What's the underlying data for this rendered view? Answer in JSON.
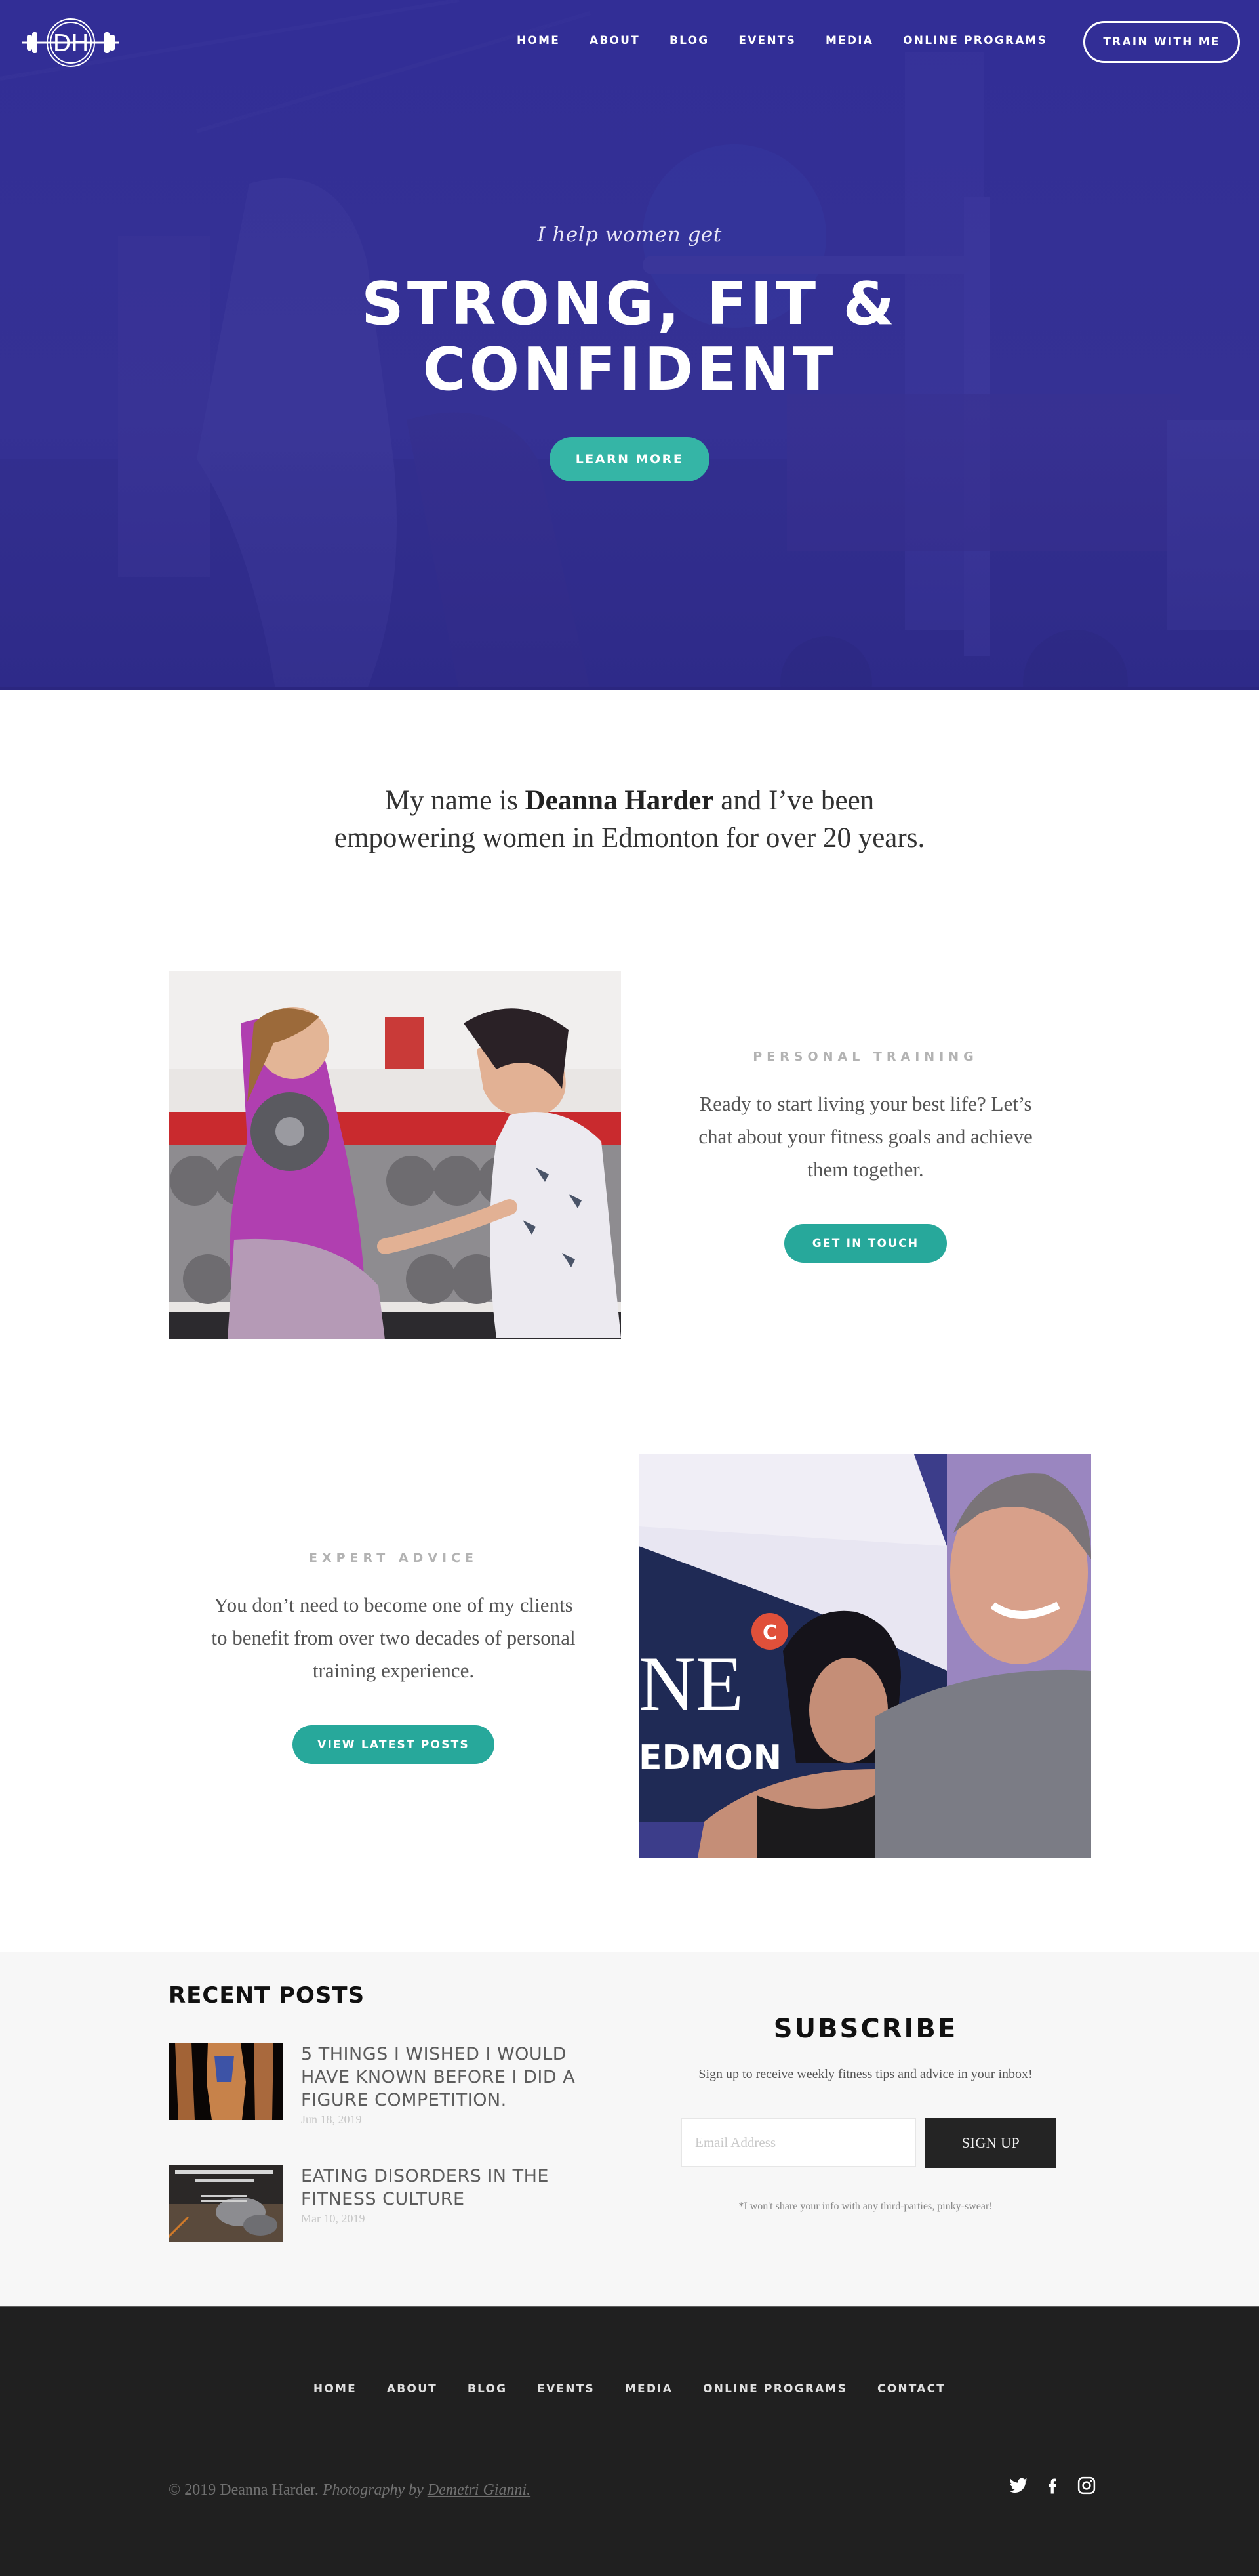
{
  "header": {
    "logo_text": "DH",
    "nav": [
      {
        "label": "HOME"
      },
      {
        "label": "ABOUT"
      },
      {
        "label": "BLOG"
      },
      {
        "label": "EVENTS"
      },
      {
        "label": "MEDIA"
      },
      {
        "label": "ONLINE PROGRAMS"
      }
    ],
    "cta_label": "TRAIN WITH ME"
  },
  "hero": {
    "pretitle": "I help women get",
    "title_line1": "STRONG, FIT &",
    "title_line2": "CONFIDENT",
    "button_label": "LEARN MORE",
    "overlay_color": "#35338c"
  },
  "intro": {
    "prefix": "My name is",
    "name": "Deanna Harder",
    "suffix_line1": "and I’ve been",
    "line2": "empowering women in Edmonton for over 20 years."
  },
  "features": [
    {
      "eyebrow": "PERSONAL TRAINING",
      "body": "Ready to start living your best life? Let’s chat about your fitness goals and achieve them together.",
      "button_label": "GET IN TOUCH",
      "photo": "trainer-with-client-dumbbell-curl"
    },
    {
      "eyebrow": "EXPERT ADVICE",
      "body": "You don’t need to become one of my clients to benefit from over two decades of personal training experience.",
      "button_label": "VIEW LATEST POSTS",
      "photo": "selfie-at-news-studio"
    }
  ],
  "recent_posts": {
    "title": "RECENT POSTS",
    "items": [
      {
        "title": "5 THINGS I WISHED I WOULD HAVE KNOWN BEFORE I DID A FIGURE COMPETITION.",
        "date": "Jun 18, 2019"
      },
      {
        "title": "EATING DISORDERS IN THE FITNESS CULTURE",
        "date": "Mar 10, 2019"
      }
    ]
  },
  "subscribe": {
    "title": "SUBSCRIBE",
    "description": "Sign up to receive weekly fitness tips and advice in your inbox!",
    "email_placeholder": "Email Address",
    "email_value": "",
    "button_label": "SIGN UP",
    "note": "*I won't share your info with any third-parties, pinky-swear!"
  },
  "footer": {
    "nav": [
      {
        "label": "HOME"
      },
      {
        "label": "ABOUT"
      },
      {
        "label": "BLOG"
      },
      {
        "label": "EVENTS"
      },
      {
        "label": "MEDIA"
      },
      {
        "label": "ONLINE PROGRAMS"
      },
      {
        "label": "CONTACT"
      }
    ],
    "copyright": "© 2019 Deanna Harder.",
    "photo_credit_prefix": "Photography by",
    "photo_credit_name": "Demetri Gianni.",
    "social": [
      "twitter-icon",
      "facebook-icon",
      "instagram-icon"
    ]
  },
  "colors": {
    "accent": "#27a89b",
    "hero_button": "#35b5a6",
    "hero_overlay": "#35338c",
    "footer_bg": "#202020",
    "band_bg": "#f7f7f7"
  }
}
